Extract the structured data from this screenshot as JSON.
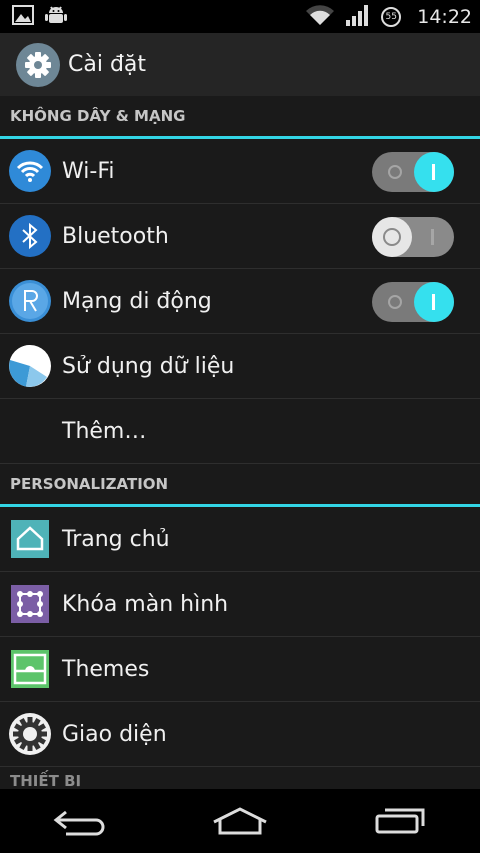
{
  "status_bar": {
    "time": "14:22",
    "battery_level": "55",
    "icons": [
      "image-icon",
      "android-debug-icon",
      "wifi-signal-icon",
      "cell-signal-icon",
      "battery-icon"
    ]
  },
  "action_bar": {
    "title": "Cài đặt",
    "icon": "settings-gear-icon"
  },
  "sections": {
    "wireless": {
      "header": "KHÔNG DÂY & MẠNG",
      "items": [
        {
          "label": "Wi-Fi",
          "icon": "wifi-icon",
          "toggle": "on"
        },
        {
          "label": "Bluetooth",
          "icon": "bluetooth-icon",
          "toggle": "off"
        },
        {
          "label": "Mạng di động",
          "icon": "mobile-network-icon",
          "toggle": "on"
        },
        {
          "label": "Sử dụng dữ liệu",
          "icon": "data-usage-icon"
        },
        {
          "label": "Thêm…"
        }
      ]
    },
    "personalization": {
      "header": "PERSONALIZATION",
      "items": [
        {
          "label": "Trang chủ",
          "icon": "home-icon"
        },
        {
          "label": "Khóa màn hình",
          "icon": "lock-screen-icon"
        },
        {
          "label": "Themes",
          "icon": "themes-icon"
        },
        {
          "label": "Giao diện",
          "icon": "display-gear-icon"
        }
      ]
    },
    "device": {
      "header": "THIẾT BỊ"
    }
  },
  "colors": {
    "accent": "#33d6e6",
    "switch_on": "#35e0ee",
    "background": "#1a1a1a",
    "action_bar": "#252525"
  },
  "nav_bar": {
    "buttons": [
      "back-icon",
      "home-nav-icon",
      "recents-icon"
    ]
  }
}
